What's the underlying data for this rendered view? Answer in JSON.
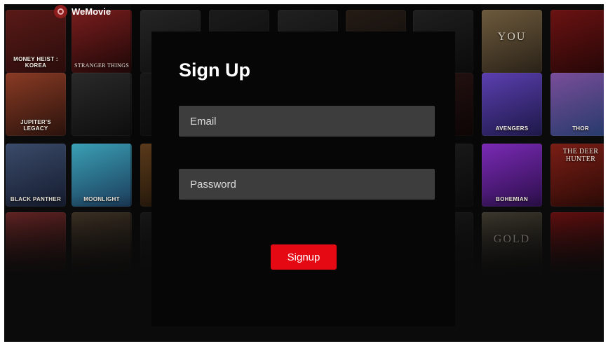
{
  "brand": {
    "name": "WeMovie",
    "icon": "reel-logo-icon"
  },
  "form": {
    "title": "Sign Up",
    "email_placeholder": "Email",
    "password_placeholder": "Password",
    "submit_label": "Signup"
  },
  "posters": [
    {
      "title": "MONEY HEIST : KOREA"
    },
    {
      "title": "STRANGER THINGS"
    },
    {
      "title": ""
    },
    {
      "title": ""
    },
    {
      "title": ""
    },
    {
      "title": ""
    },
    {
      "title": ""
    },
    {
      "title": ""
    },
    {
      "title": "YOU"
    },
    {
      "title": ""
    },
    {
      "title": "JUPITER'S LEGACY"
    },
    {
      "title": ""
    },
    {
      "title": ""
    },
    {
      "title": ""
    },
    {
      "title": ""
    },
    {
      "title": ""
    },
    {
      "title": ""
    },
    {
      "title": ""
    },
    {
      "title": "AVENGERS"
    },
    {
      "title": "THOR"
    },
    {
      "title": "BLACK PANTHER"
    },
    {
      "title": "MOONLIGHT"
    },
    {
      "title": ""
    },
    {
      "title": ""
    },
    {
      "title": ""
    },
    {
      "title": ""
    },
    {
      "title": ""
    },
    {
      "title": ""
    },
    {
      "title": "BOHEMIAN"
    },
    {
      "title": "THE DEER HUNTER"
    },
    {
      "title": ""
    },
    {
      "title": ""
    },
    {
      "title": ""
    },
    {
      "title": ""
    },
    {
      "title": ""
    },
    {
      "title": ""
    },
    {
      "title": ""
    },
    {
      "title": ""
    },
    {
      "title": "GOLD"
    },
    {
      "title": ""
    }
  ],
  "colors": {
    "accent": "#e50914",
    "modal_bg": "#060606",
    "field_bg": "#3d3d3d"
  }
}
